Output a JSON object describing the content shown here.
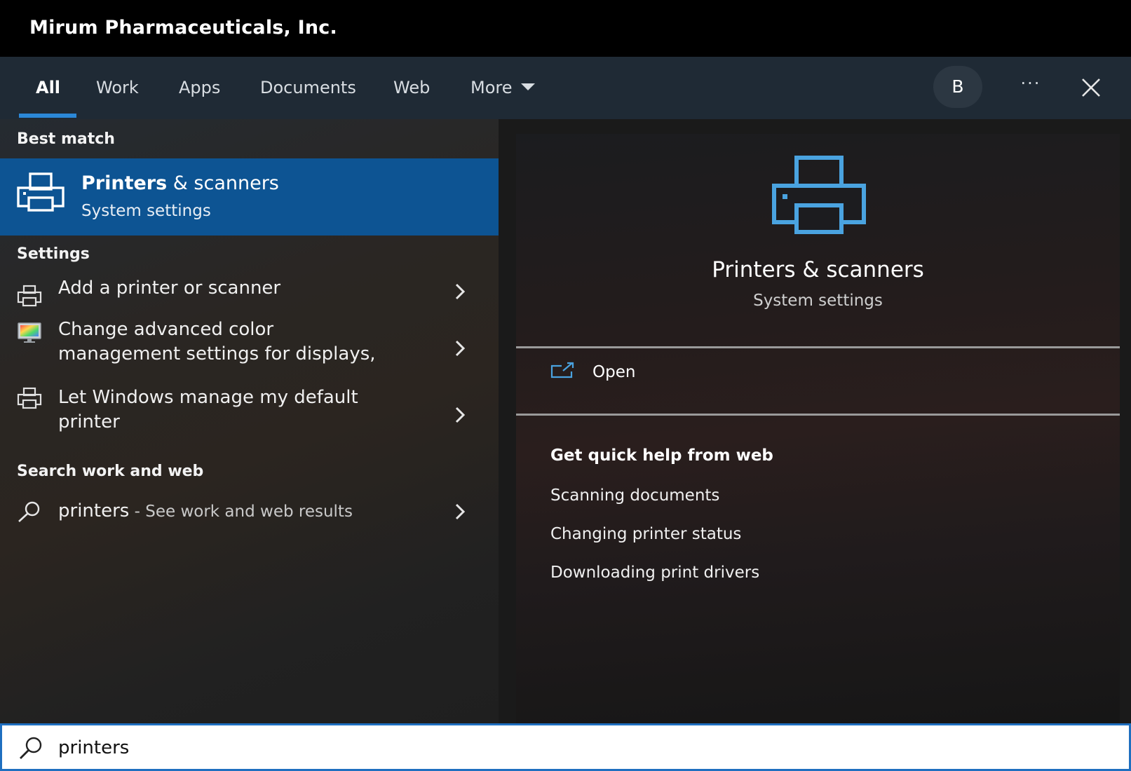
{
  "window": {
    "title": "Mirum Pharmaceuticals, Inc."
  },
  "tabs": [
    {
      "label": "All",
      "active": true
    },
    {
      "label": "Work"
    },
    {
      "label": "Apps"
    },
    {
      "label": "Documents"
    },
    {
      "label": "Web"
    },
    {
      "label": "More"
    }
  ],
  "header_actions": {
    "avatar_initial": "B",
    "more_options": "···"
  },
  "left": {
    "best_match_header": "Best match",
    "best_match": {
      "title_bold": "Printers",
      "title_rest": " & scanners",
      "subtitle": "System settings",
      "icon": "printer-icon"
    },
    "settings_header": "Settings",
    "settings_items": [
      {
        "lines": [
          "Add a printer or scanner"
        ],
        "icon": "printer-icon"
      },
      {
        "lines": [
          "Change advanced color",
          "management settings for displays,"
        ],
        "icon": "color-monitor-icon"
      },
      {
        "lines": [
          "Let Windows manage my default",
          "printer"
        ],
        "icon": "printer-icon"
      }
    ],
    "search_header": "Search work and web",
    "search_item": {
      "term": "printers",
      "hint": " - See work and web results",
      "icon": "search-icon"
    }
  },
  "right": {
    "title": "Printers & scanners",
    "subtitle": "System settings",
    "open_label": "Open",
    "help_header": "Get quick help from web",
    "help_links": [
      "Scanning documents",
      "Changing printer status",
      "Downloading print drivers"
    ]
  },
  "search": {
    "value": "printers"
  },
  "colors": {
    "accent": "#2b88d8",
    "selection": "#0d5493",
    "icon_blue": "#4aa3e0"
  }
}
